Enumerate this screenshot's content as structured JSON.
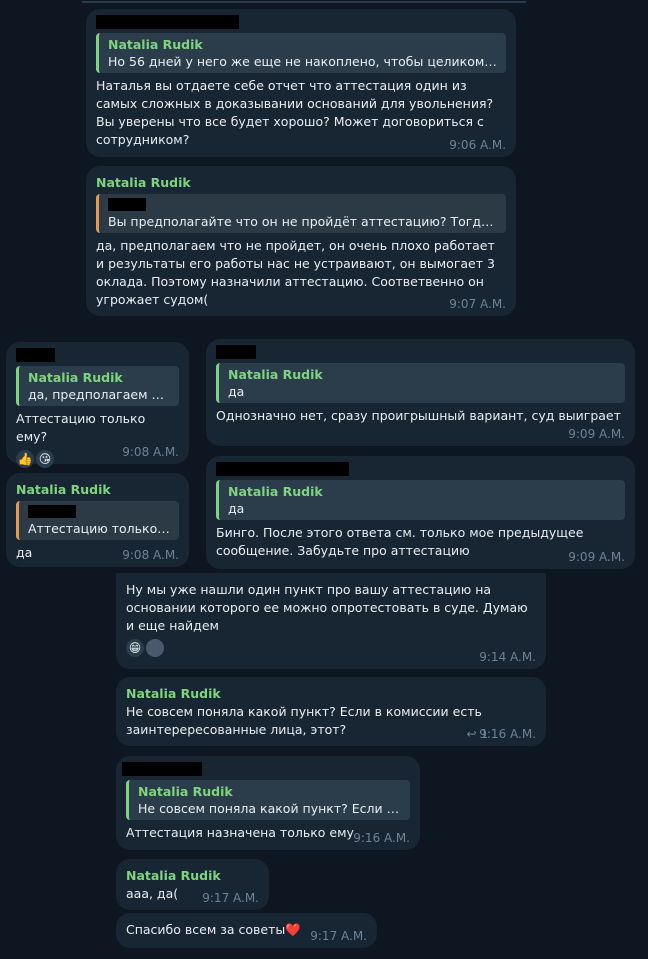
{
  "messages": {
    "m1": {
      "reply_name": "Natalia Rudik",
      "reply_text": "Но 56 дней у него же еще не накоплено, чтобы целиком ег...",
      "text": "Наталья вы отдаете себе отчет что аттестация один из самых сложных в доказывании оснований для увольнения? Вы уверены что все будет хорошо? Может договориться с сотрудником?",
      "time": "9:06 A.M."
    },
    "m2": {
      "sender": "Natalia Rudik",
      "reply_text": "Вы предполагайте что он не пройдёт аттестацию? Тогда бо...",
      "text": "да, предполагаем что не пройдет, он очень плохо работает и результаты его работы нас не устраивают, он вымогает 3 оклада. Поэтому назначили аттестацию. Соответвенно он угрожает судом(",
      "time": "9:07 A.M."
    },
    "m3": {
      "reply_name": "Natalia Rudik",
      "reply_text": "да, предполагаем чт...",
      "text": "Аттестацию только ему?",
      "reactions": [
        "thumbs-up",
        "kiss"
      ],
      "time": "9:08 A.M."
    },
    "m4": {
      "reply_name": "Natalia Rudik",
      "reply_text": "да",
      "text": "Однозначно нет, сразу проигрышный вариант, суд выиграет",
      "time": "9:09 A.M."
    },
    "m5": {
      "sender": "Natalia Rudik",
      "reply_text": "Аттестацию только е...",
      "text": "да",
      "time": "9:08 A.M."
    },
    "m6": {
      "reply_name": "Natalia Rudik",
      "reply_text": "да",
      "text": "Бинго. После этого ответа см. только мое предыдущее сообщение. Забудьте про аттестацию",
      "time": "9:09 A.M."
    },
    "m7": {
      "text": "Ну мы уже нашли один пункт про вашу аттестацию на основании которого ее можно опротестовать в суде. Думаю и еще найдем",
      "reactions": [
        "grin",
        "avatar"
      ],
      "time": "9:14 A.M."
    },
    "m8": {
      "sender": "Natalia Rudik",
      "text": "Не совсем поняла какой пункт? Если в комиссии есть заинтерересованные лица, этот?",
      "replies_count": "1",
      "time": "9:16 A.M."
    },
    "m9": {
      "reply_name": "Natalia Rudik",
      "reply_text": "Не совсем поняла какой пункт? Если в к...",
      "text": "Аттестация назначена только ему",
      "time": "9:16 A.M."
    },
    "m10": {
      "sender": "Natalia Rudik",
      "text": "ааа, да(",
      "time": "9:17 A.M."
    },
    "m11": {
      "text": "Спасибо всем за советы",
      "emoji": "❤️",
      "time": "9:17 A.M."
    }
  },
  "colors": {
    "background": "#0e1621",
    "bubble": "#182533",
    "sender_green": "#7fd47f",
    "reply_orange": "#e59a4e",
    "time": "#6d8396"
  }
}
